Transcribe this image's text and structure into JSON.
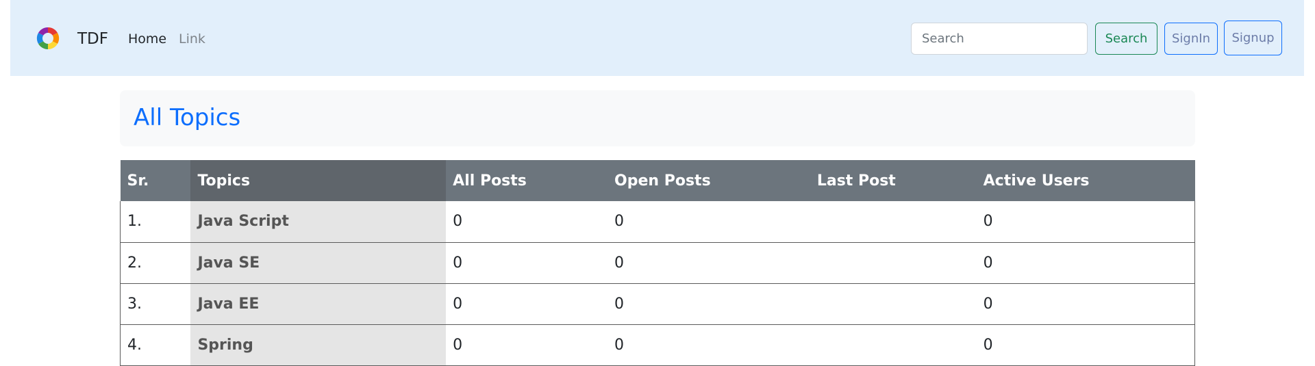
{
  "navbar": {
    "brand": "TDF",
    "logo_icon": "multicolor-ring-logo",
    "links": [
      "Home",
      "Link"
    ],
    "search_placeholder": "Search",
    "search_value": "",
    "search_button": "Search",
    "signin_button": "SignIn",
    "signup_button": "Signup",
    "background": "#e2effb"
  },
  "page": {
    "title": "All Topics",
    "title_color": "#0d6efd"
  },
  "table": {
    "headers": [
      "Sr.",
      "Topics",
      "All Posts",
      "Open Posts",
      "Last Post",
      "Active Users"
    ],
    "rows": [
      [
        "1.",
        "Java Script",
        "0",
        "0",
        "",
        "0"
      ],
      [
        "2.",
        "Java SE",
        "0",
        "0",
        "",
        "0"
      ],
      [
        "3.",
        "Java EE",
        "0",
        "0",
        "",
        "0"
      ],
      [
        "4.",
        "Spring",
        "0",
        "0",
        "",
        "0"
      ]
    ]
  }
}
